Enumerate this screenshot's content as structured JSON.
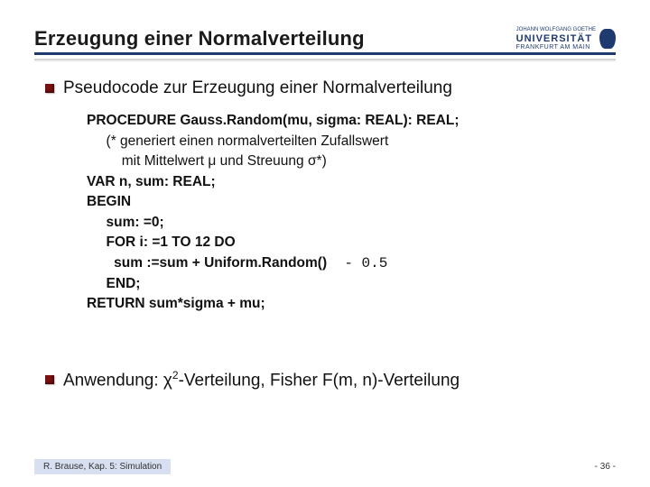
{
  "header": {
    "title": "Erzeugung einer Normalverteilung",
    "logo": {
      "top_line": "JOHANN WOLFGANG GOETHE",
      "name": "UNIVERSITÄT",
      "city": "FRANKFURT AM MAIN"
    }
  },
  "bullets": {
    "b1": "Pseudocode zur Erzeugung einer Normalverteilung",
    "b2_prefix": "Anwendung: ",
    "b2_chi": "χ",
    "b2_exp": "2",
    "b2_suffix": "-Verteilung, Fisher F(m, n)-Verteilung"
  },
  "code": {
    "l1": "PROCEDURE Gauss.Random(mu, sigma: REAL): REAL;",
    "l2": "     (* generiert einen normalverteilten Zufallswert",
    "l3": "         mit Mittelwert μ und Streuung σ*)",
    "l4": "VAR n, sum: REAL;",
    "l5": "BEGIN",
    "l6": "     sum: =0;",
    "l7": "     FOR i: =1 TO 12 DO",
    "l8a": "       sum :=sum + Uniform.Random()",
    "l8b": "  - 0.5",
    "l9": "     END;",
    "l10": "RETURN sum*sigma + mu;"
  },
  "footer": {
    "left": "R. Brause, Kap. 5: Simulation",
    "right": "- 36 -"
  }
}
